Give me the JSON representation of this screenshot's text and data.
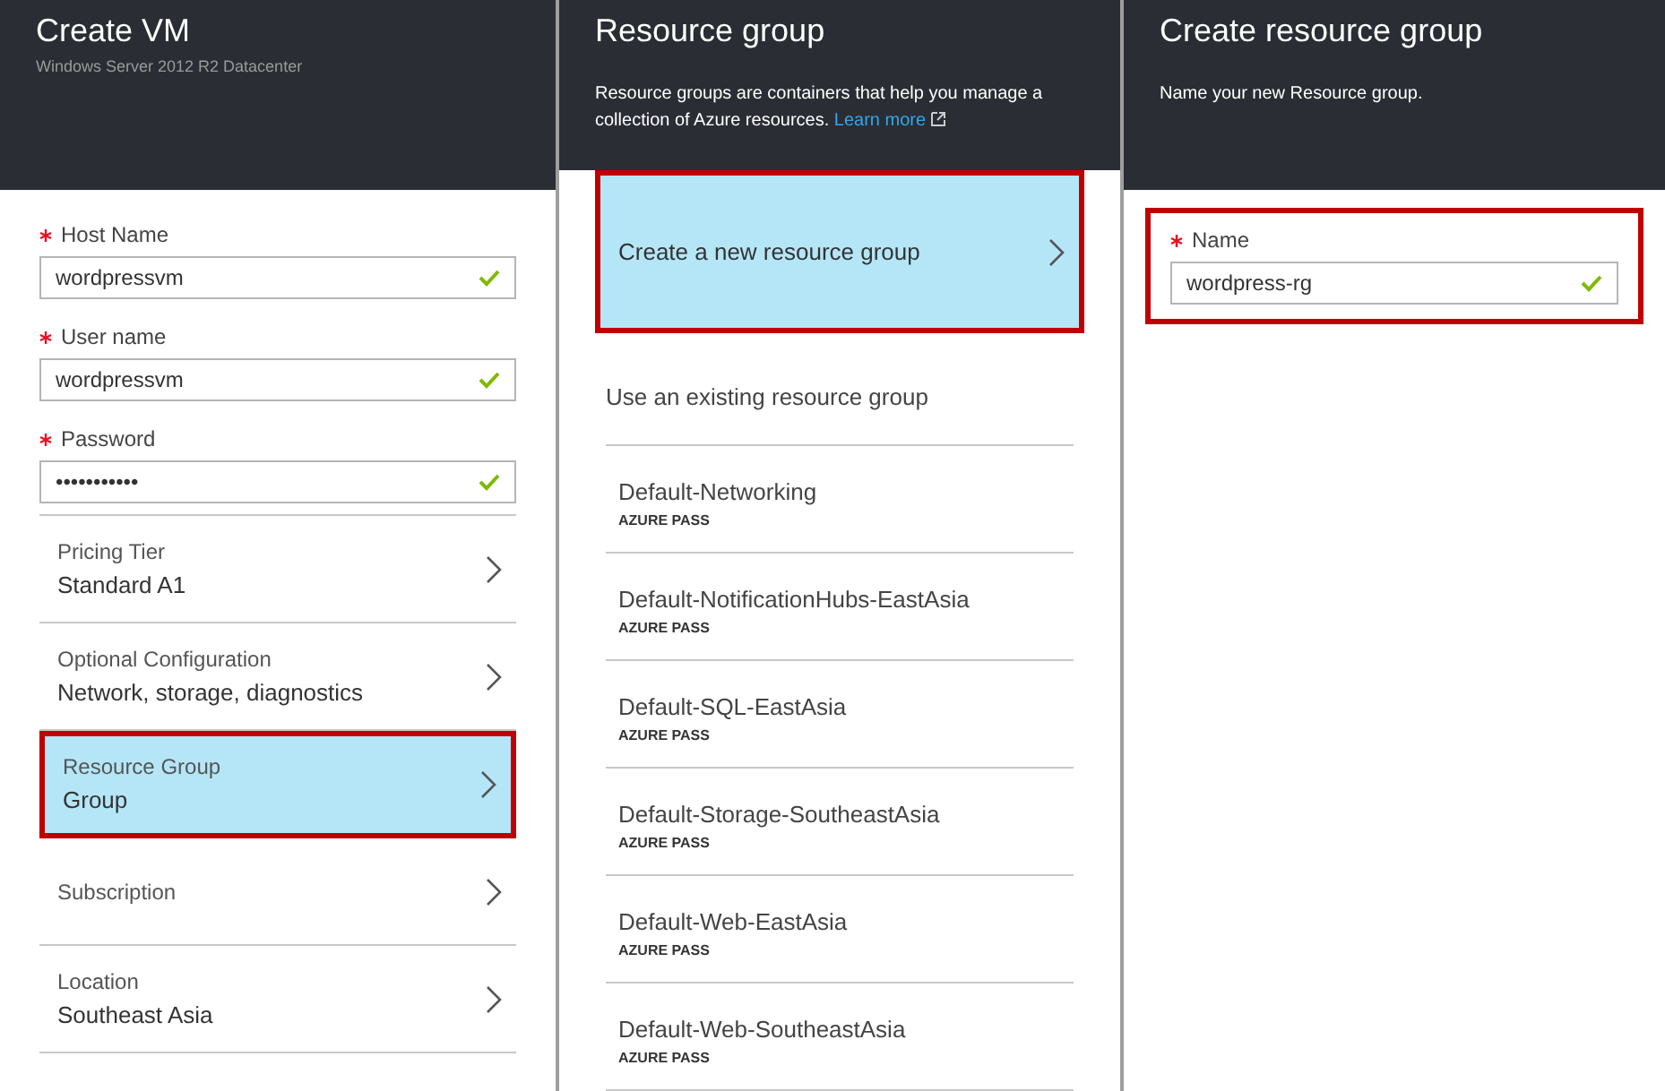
{
  "blades": [
    {
      "title": "Create VM",
      "subtitle": "Windows Server 2012 R2 Datacenter",
      "fields": [
        {
          "label": "Host Name",
          "required": true,
          "value": "wordpressvm",
          "valid": true
        },
        {
          "label": "User name",
          "required": true,
          "value": "wordpressvm",
          "valid": true
        },
        {
          "label": "Password",
          "required": true,
          "value": "•••••••••••",
          "valid": true
        }
      ],
      "nav_items": [
        {
          "label": "Pricing Tier",
          "value": "Standard A1",
          "selected": false
        },
        {
          "label": "Optional Configuration",
          "value": "Network, storage, diagnostics",
          "selected": false
        },
        {
          "label": "Resource Group",
          "value": "Group",
          "selected": true
        },
        {
          "label": "Subscription",
          "selected": false
        },
        {
          "label": "Location",
          "value": "Southeast Asia",
          "selected": false
        }
      ]
    },
    {
      "title": "Resource group",
      "description": "Resource groups are containers that help you manage a collection of Azure resources.",
      "link": "Learn more",
      "nav_items": [
        {
          "value": "Create a new resource group",
          "selected": true
        }
      ],
      "section_label": "Use an existing resource group",
      "groups": [
        {
          "name": "Default-Networking",
          "subscription": "AZURE PASS"
        },
        {
          "name": "Default-NotificationHubs-EastAsia",
          "subscription": "AZURE PASS"
        },
        {
          "name": "Default-SQL-EastAsia",
          "subscription": "AZURE PASS"
        },
        {
          "name": "Default-Storage-SoutheastAsia",
          "subscription": "AZURE PASS"
        },
        {
          "name": "Default-Web-EastAsia",
          "subscription": "AZURE PASS"
        },
        {
          "name": "Default-Web-SoutheastAsia",
          "subscription": "AZURE PASS"
        }
      ]
    },
    {
      "title": "Create resource group",
      "description": "Name your new Resource group.",
      "fields": [
        {
          "label": "Name",
          "required": true,
          "value": "wordpress-rg",
          "valid": true,
          "highlighted": true
        }
      ]
    }
  ]
}
